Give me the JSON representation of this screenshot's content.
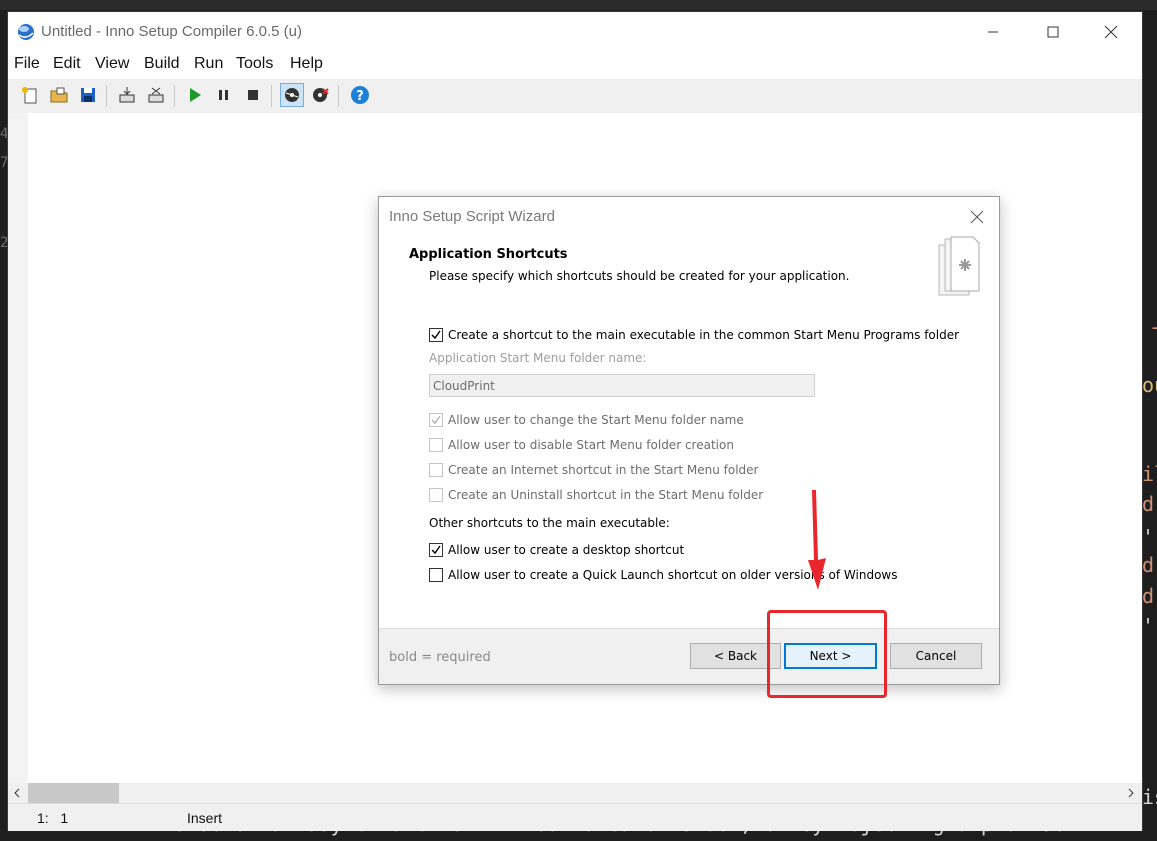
{
  "window": {
    "title": "Untitled - Inno Setup Compiler 6.0.5 (u)"
  },
  "menu": [
    "File",
    "Edit",
    "View",
    "Build",
    "Run",
    "Tools",
    "Help"
  ],
  "toolbar": {
    "buttons": [
      "new-file-icon",
      "open-folder-icon",
      "save-icon",
      "compile-icon",
      "stop-compile-icon",
      "run-icon",
      "pause-icon",
      "stop-icon",
      "target-debug-icon",
      "target-uninstall-icon",
      "help-icon"
    ]
  },
  "status": {
    "position": "1:   1",
    "mode": "Insert"
  },
  "dialog": {
    "title": "Inno Setup Script Wizard",
    "heading": "Application Shortcuts",
    "subheading": "Please specify which shortcuts should be created for your application.",
    "create_start_menu": {
      "label": "Create a shortcut to the main executable in the common Start Menu Programs folder",
      "checked": true,
      "enabled": true
    },
    "folder_name_label": "Application Start Menu folder name:",
    "folder_name_value": "CloudPrint",
    "options": [
      {
        "label": "Allow user to change the Start Menu folder name",
        "checked": true,
        "enabled": false
      },
      {
        "label": "Allow user to disable Start Menu folder creation",
        "checked": false,
        "enabled": false
      },
      {
        "label": "Create an Internet shortcut in the Start Menu folder",
        "checked": false,
        "enabled": false
      },
      {
        "label": "Create an Uninstall shortcut in the Start Menu folder",
        "checked": false,
        "enabled": false
      }
    ],
    "other_label": "Other shortcuts to the main executable:",
    "desktop": {
      "label": "Allow user to create a desktop shortcut",
      "checked": true,
      "enabled": true
    },
    "quicklaunch": {
      "label": "Allow user to create a Quick Launch shortcut on older versions of Windows",
      "checked": false,
      "enabled": true
    },
    "footer_bold": "bold",
    "footer_rest": " = required",
    "back": "< Back",
    "next": "Next >",
    "cancel": "Cancel"
  },
  "background": {
    "line_numbers": [
      "4",
      "7",
      "2"
    ],
    "code_fragments": [
      "-",
      "ou",
      "il",
      "d.",
      "',",
      "d.",
      "d.",
      "',",
      "is"
    ],
    "bottom_text": "inside of an async function without a catch block, or by rejecting a promise whi"
  },
  "colors": {
    "accent": "#0078d7",
    "annotation": "#e8262b",
    "code_orange": "#ce9178",
    "code_yellow": "#d7ba7d"
  }
}
